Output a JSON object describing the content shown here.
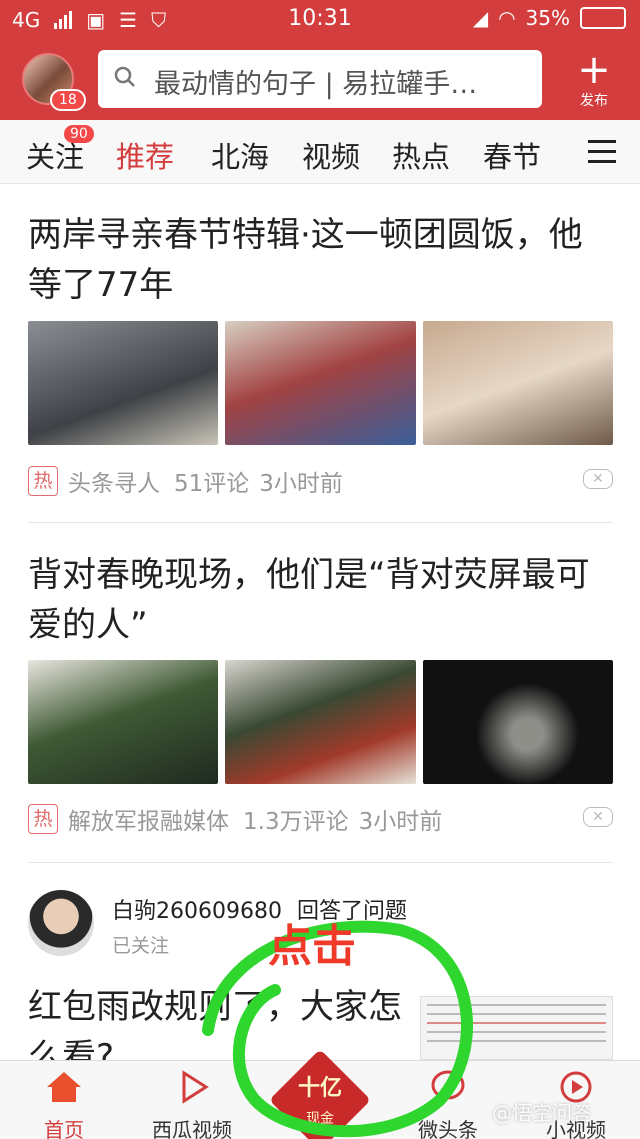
{
  "status_bar": {
    "network": "4G",
    "time": "10:31",
    "battery": "35%"
  },
  "header": {
    "avatar_badge": "18",
    "search_placeholder": "最动情的句子 | 易拉罐手…",
    "publish_label": "发布"
  },
  "tabs": [
    {
      "label": "关注",
      "badge": "90"
    },
    {
      "label": "推荐",
      "active": true
    },
    {
      "label": "北海"
    },
    {
      "label": "视频"
    },
    {
      "label": "热点"
    },
    {
      "label": "春节"
    }
  ],
  "articles": [
    {
      "title": "两岸寻亲春节特辑·这一顿团圆饭，他等了77年",
      "hot_tag": "热",
      "source": "头条寻人",
      "comments": "51评论",
      "time": "3小时前"
    },
    {
      "title": "背对春晚现场，他们是“背对荧屏最可爱的人”",
      "hot_tag": "热",
      "source": "解放军报融媒体",
      "comments": "1.3万评论",
      "time": "3小时前"
    }
  ],
  "answer_card": {
    "user": "白驹260609680",
    "action": "回答了问题",
    "follow_status": "已关注",
    "question_title": "红包雨改规则了，大家怎么看?"
  },
  "annotation": {
    "text": "点击",
    "color": "#ef3a2a",
    "circle_color": "#2ed62e"
  },
  "bottom_nav": [
    {
      "label": "首页",
      "active": true
    },
    {
      "label": "西瓜视频"
    },
    {
      "label": "",
      "center": true,
      "badge_text": "十亿",
      "badge_sub": "现金"
    },
    {
      "label": "微头条"
    },
    {
      "label": "小视频"
    }
  ],
  "watermark": "@悟空问答",
  "colors": {
    "brand_red": "#d43d3d",
    "active_tab": "#d43d3d"
  }
}
